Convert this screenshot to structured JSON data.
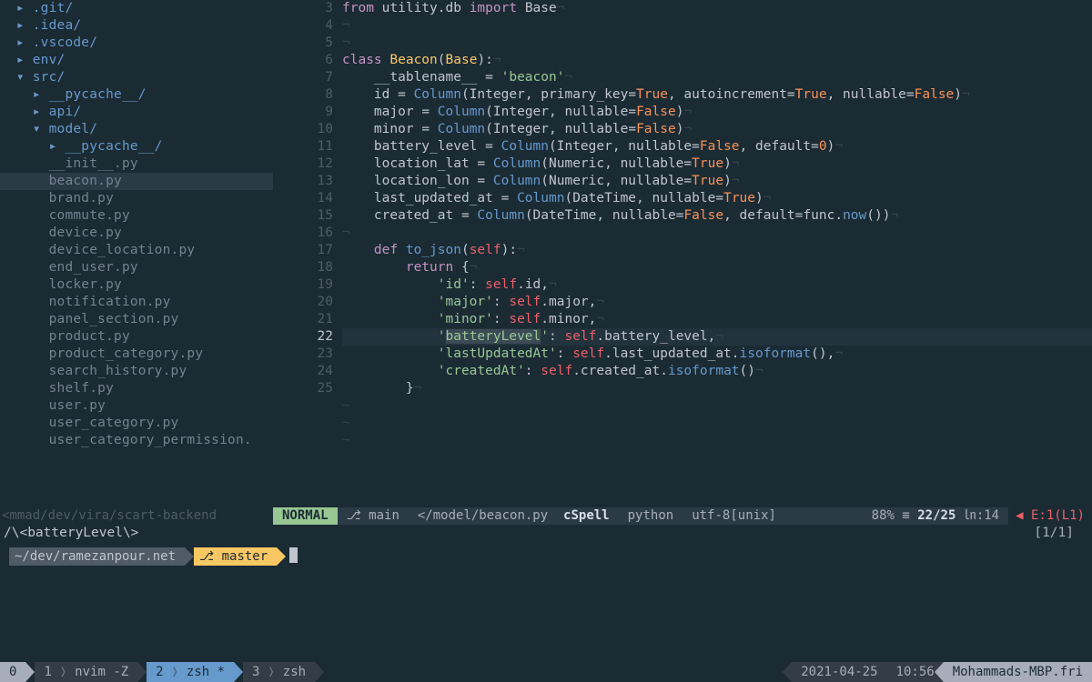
{
  "tree": [
    {
      "t": "▸ .git/",
      "cls": "dir",
      "ind": 0
    },
    {
      "t": "▸ .idea/",
      "cls": "dir",
      "ind": 0
    },
    {
      "t": "▸ .vscode/",
      "cls": "dir",
      "ind": 0
    },
    {
      "t": "▸ env/",
      "cls": "dir",
      "ind": 0
    },
    {
      "t": "▾ src/",
      "cls": "dir",
      "ind": 0
    },
    {
      "t": "▸ __pycache__/",
      "cls": "dir",
      "ind": 1
    },
    {
      "t": "▸ api/",
      "cls": "dir",
      "ind": 1
    },
    {
      "t": "▾ model/",
      "cls": "dir",
      "ind": 1
    },
    {
      "t": "▸ __pycache__/",
      "cls": "dir",
      "ind": 2
    },
    {
      "t": "__init__.py",
      "cls": "",
      "ind": 2
    },
    {
      "t": "beacon.py",
      "cls": "sel",
      "ind": 2
    },
    {
      "t": "brand.py",
      "cls": "",
      "ind": 2
    },
    {
      "t": "commute.py",
      "cls": "",
      "ind": 2
    },
    {
      "t": "device.py",
      "cls": "",
      "ind": 2
    },
    {
      "t": "device_location.py",
      "cls": "",
      "ind": 2
    },
    {
      "t": "end_user.py",
      "cls": "",
      "ind": 2
    },
    {
      "t": "locker.py",
      "cls": "",
      "ind": 2
    },
    {
      "t": "notification.py",
      "cls": "",
      "ind": 2
    },
    {
      "t": "panel_section.py",
      "cls": "",
      "ind": 2
    },
    {
      "t": "product.py",
      "cls": "",
      "ind": 2
    },
    {
      "t": "product_category.py",
      "cls": "",
      "ind": 2
    },
    {
      "t": "search_history.py",
      "cls": "",
      "ind": 2
    },
    {
      "t": "shelf.py",
      "cls": "",
      "ind": 2
    },
    {
      "t": "user.py",
      "cls": "",
      "ind": 2
    },
    {
      "t": "user_category.py",
      "cls": "",
      "ind": 2
    },
    {
      "t": "user_category_permission.",
      "cls": "",
      "ind": 2
    }
  ],
  "code": {
    "start": 3,
    "current": 22,
    "lines": [
      [
        [
          "kw",
          "from"
        ],
        [
          "var",
          " utility"
        ],
        [
          "punc",
          "."
        ],
        [
          "var",
          "db "
        ],
        [
          "kw",
          "import"
        ],
        [
          "var",
          " Base"
        ],
        [
          "ws",
          "¬"
        ]
      ],
      [
        [
          "ws",
          "¬"
        ]
      ],
      [
        [
          "ws",
          "¬"
        ]
      ],
      [
        [
          "kw",
          "class"
        ],
        [
          "var",
          " "
        ],
        [
          "cls",
          "Beacon"
        ],
        [
          "punc",
          "("
        ],
        [
          "cls",
          "Base"
        ],
        [
          "punc",
          "):"
        ],
        [
          "ws",
          "¬"
        ]
      ],
      [
        [
          "var",
          "    __tablename__ "
        ],
        [
          "punc",
          "="
        ],
        [
          "var",
          " "
        ],
        [
          "str",
          "'beacon'"
        ],
        [
          "ws",
          "¬"
        ]
      ],
      [
        [
          "var",
          "    id "
        ],
        [
          "punc",
          "="
        ],
        [
          "var",
          " "
        ],
        [
          "fn",
          "Column"
        ],
        [
          "punc",
          "("
        ],
        [
          "var",
          "Integer"
        ],
        [
          "punc",
          ","
        ],
        [
          "var",
          " primary_key"
        ],
        [
          "punc",
          "="
        ],
        [
          "num",
          "True"
        ],
        [
          "punc",
          ","
        ],
        [
          "var",
          " autoincrement"
        ],
        [
          "punc",
          "="
        ],
        [
          "num",
          "True"
        ],
        [
          "punc",
          ","
        ],
        [
          "var",
          " nullable"
        ],
        [
          "punc",
          "="
        ],
        [
          "num",
          "False"
        ],
        [
          "punc",
          ")"
        ],
        [
          "ws",
          "¬"
        ]
      ],
      [
        [
          "var",
          "    major "
        ],
        [
          "punc",
          "="
        ],
        [
          "var",
          " "
        ],
        [
          "fn",
          "Column"
        ],
        [
          "punc",
          "("
        ],
        [
          "var",
          "Integer"
        ],
        [
          "punc",
          ","
        ],
        [
          "var",
          " nullable"
        ],
        [
          "punc",
          "="
        ],
        [
          "num",
          "False"
        ],
        [
          "punc",
          ")"
        ],
        [
          "ws",
          "¬"
        ]
      ],
      [
        [
          "var",
          "    minor "
        ],
        [
          "punc",
          "="
        ],
        [
          "var",
          " "
        ],
        [
          "fn",
          "Column"
        ],
        [
          "punc",
          "("
        ],
        [
          "var",
          "Integer"
        ],
        [
          "punc",
          ","
        ],
        [
          "var",
          " nullable"
        ],
        [
          "punc",
          "="
        ],
        [
          "num",
          "False"
        ],
        [
          "punc",
          ")"
        ],
        [
          "ws",
          "¬"
        ]
      ],
      [
        [
          "var",
          "    battery_level "
        ],
        [
          "punc",
          "="
        ],
        [
          "var",
          " "
        ],
        [
          "fn",
          "Column"
        ],
        [
          "punc",
          "("
        ],
        [
          "var",
          "Integer"
        ],
        [
          "punc",
          ","
        ],
        [
          "var",
          " nullable"
        ],
        [
          "punc",
          "="
        ],
        [
          "num",
          "False"
        ],
        [
          "punc",
          ","
        ],
        [
          "var",
          " default"
        ],
        [
          "punc",
          "="
        ],
        [
          "num",
          "0"
        ],
        [
          "punc",
          ")"
        ],
        [
          "ws",
          "¬"
        ]
      ],
      [
        [
          "var",
          "    location_lat "
        ],
        [
          "punc",
          "="
        ],
        [
          "var",
          " "
        ],
        [
          "fn",
          "Column"
        ],
        [
          "punc",
          "("
        ],
        [
          "var",
          "Numeric"
        ],
        [
          "punc",
          ","
        ],
        [
          "var",
          " nullable"
        ],
        [
          "punc",
          "="
        ],
        [
          "num",
          "True"
        ],
        [
          "punc",
          ")"
        ],
        [
          "ws",
          "¬"
        ]
      ],
      [
        [
          "var",
          "    location_lon "
        ],
        [
          "punc",
          "="
        ],
        [
          "var",
          " "
        ],
        [
          "fn",
          "Column"
        ],
        [
          "punc",
          "("
        ],
        [
          "var",
          "Numeric"
        ],
        [
          "punc",
          ","
        ],
        [
          "var",
          " nullable"
        ],
        [
          "punc",
          "="
        ],
        [
          "num",
          "True"
        ],
        [
          "punc",
          ")"
        ],
        [
          "ws",
          "¬"
        ]
      ],
      [
        [
          "var",
          "    last_updated_at "
        ],
        [
          "punc",
          "="
        ],
        [
          "var",
          " "
        ],
        [
          "fn",
          "Column"
        ],
        [
          "punc",
          "("
        ],
        [
          "var",
          "DateTime"
        ],
        [
          "punc",
          ","
        ],
        [
          "var",
          " nullable"
        ],
        [
          "punc",
          "="
        ],
        [
          "num",
          "True"
        ],
        [
          "punc",
          ")"
        ],
        [
          "ws",
          "¬"
        ]
      ],
      [
        [
          "var",
          "    created_at "
        ],
        [
          "punc",
          "="
        ],
        [
          "var",
          " "
        ],
        [
          "fn",
          "Column"
        ],
        [
          "punc",
          "("
        ],
        [
          "var",
          "DateTime"
        ],
        [
          "punc",
          ","
        ],
        [
          "var",
          " nullable"
        ],
        [
          "punc",
          "="
        ],
        [
          "num",
          "False"
        ],
        [
          "punc",
          ","
        ],
        [
          "var",
          " default"
        ],
        [
          "punc",
          "="
        ],
        [
          "var",
          "func"
        ],
        [
          "punc",
          "."
        ],
        [
          "fn",
          "now"
        ],
        [
          "punc",
          "())"
        ],
        [
          "ws",
          "¬"
        ]
      ],
      [
        [
          "ws",
          "¬"
        ]
      ],
      [
        [
          "var",
          "    "
        ],
        [
          "kw",
          "def"
        ],
        [
          "var",
          " "
        ],
        [
          "fn",
          "to_json"
        ],
        [
          "punc",
          "("
        ],
        [
          "slf",
          "self"
        ],
        [
          "punc",
          "):"
        ],
        [
          "ws",
          "¬"
        ]
      ],
      [
        [
          "var",
          "        "
        ],
        [
          "kw",
          "return"
        ],
        [
          "punc",
          " {"
        ],
        [
          "ws",
          "¬"
        ]
      ],
      [
        [
          "var",
          "            "
        ],
        [
          "str",
          "'id'"
        ],
        [
          "punc",
          ": "
        ],
        [
          "slf",
          "self"
        ],
        [
          "punc",
          "."
        ],
        [
          "var",
          "id"
        ],
        [
          "punc",
          ","
        ],
        [
          "ws",
          "¬"
        ]
      ],
      [
        [
          "var",
          "            "
        ],
        [
          "str",
          "'major'"
        ],
        [
          "punc",
          ": "
        ],
        [
          "slf",
          "self"
        ],
        [
          "punc",
          "."
        ],
        [
          "var",
          "major"
        ],
        [
          "punc",
          ","
        ],
        [
          "ws",
          "¬"
        ]
      ],
      [
        [
          "var",
          "            "
        ],
        [
          "str",
          "'minor'"
        ],
        [
          "punc",
          ": "
        ],
        [
          "slf",
          "self"
        ],
        [
          "punc",
          "."
        ],
        [
          "var",
          "minor"
        ],
        [
          "punc",
          ","
        ],
        [
          "ws",
          "¬"
        ]
      ],
      [
        [
          "var",
          "            "
        ],
        [
          "str",
          "'"
        ],
        [
          "hlword",
          "batteryLevel"
        ],
        [
          "str",
          "'"
        ],
        [
          "punc",
          ": "
        ],
        [
          "slf",
          "self"
        ],
        [
          "punc",
          "."
        ],
        [
          "var",
          "battery_level"
        ],
        [
          "punc",
          ","
        ],
        [
          "ws",
          "¬"
        ]
      ],
      [
        [
          "var",
          "            "
        ],
        [
          "str",
          "'lastUpdatedAt'"
        ],
        [
          "punc",
          ": "
        ],
        [
          "slf",
          "self"
        ],
        [
          "punc",
          "."
        ],
        [
          "var",
          "last_updated_at"
        ],
        [
          "punc",
          "."
        ],
        [
          "fn",
          "isoformat"
        ],
        [
          "punc",
          "(),"
        ],
        [
          "ws",
          "¬"
        ]
      ],
      [
        [
          "var",
          "            "
        ],
        [
          "str",
          "'createdAt'"
        ],
        [
          "punc",
          ": "
        ],
        [
          "slf",
          "self"
        ],
        [
          "punc",
          "."
        ],
        [
          "var",
          "created_at"
        ],
        [
          "punc",
          "."
        ],
        [
          "fn",
          "isoformat"
        ],
        [
          "punc",
          "()"
        ],
        [
          "ws",
          "¬"
        ]
      ],
      [
        [
          "var",
          "        "
        ],
        [
          "punc",
          "}"
        ],
        [
          "ws",
          "¬"
        ]
      ]
    ],
    "tildes": 3
  },
  "status": {
    "tree_path": "<mmad/dev/vira/scart-backend",
    "mode": "NORMAL",
    "branch_icon": "⎇",
    "branch": "main",
    "file": "</model/beacon.py",
    "spell": "cSpell",
    "filetype": "python",
    "encoding": "utf-8[unix]",
    "percent": "88%",
    "position": "22/25",
    "col_icon": "㏑",
    "col": ":14",
    "err": "E:1(L1)",
    "search": "/\\<batteryLevel\\>",
    "search_count": "[1/1]"
  },
  "shell": {
    "cwd": "~/dev/ramezanpour.net",
    "branch_icon": "⎇",
    "branch": "master"
  },
  "tmux": {
    "session": "0",
    "windows": [
      {
        "idx": "1",
        "name": "nvim -Z",
        "active": false
      },
      {
        "idx": "2",
        "name": "zsh *",
        "active": true
      },
      {
        "idx": "3",
        "name": "zsh",
        "active": false
      }
    ],
    "date": "2021-04-25",
    "time": "10:56",
    "host": "Mohammads-MBP.fri"
  }
}
